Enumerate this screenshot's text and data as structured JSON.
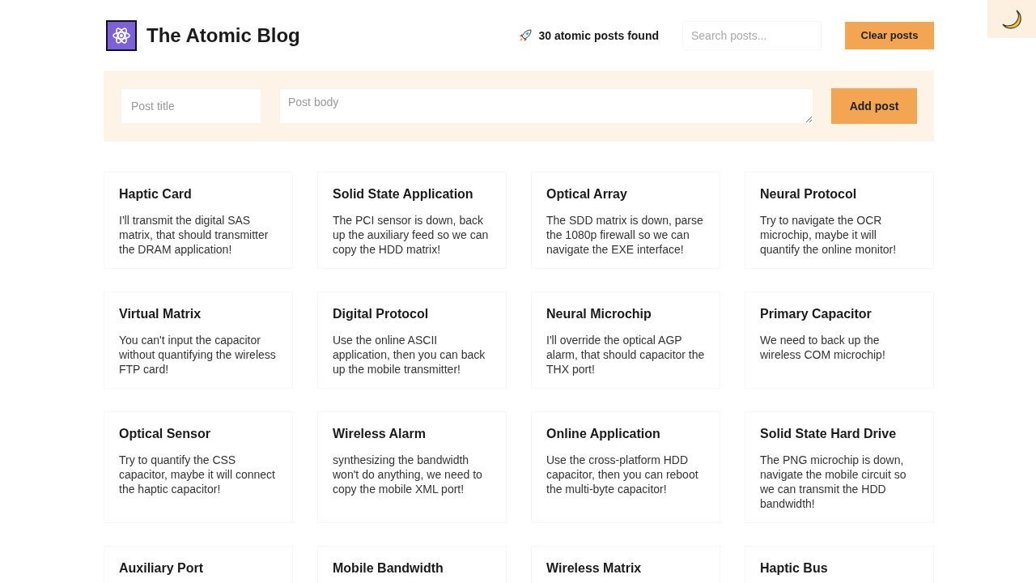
{
  "header": {
    "title": "The Atomic Blog",
    "post_count": "30 atomic posts found",
    "search": {
      "placeholder": "Search posts..."
    },
    "clear_button": "Clear posts"
  },
  "form": {
    "title_field": {
      "placeholder": "Post title"
    },
    "body_field": {
      "placeholder": "Post body"
    },
    "add_button": "Add post"
  },
  "posts": [
    {
      "title": "Haptic Card",
      "body": "I'll transmit the digital SAS matrix, that should transmitter the DRAM application!"
    },
    {
      "title": "Solid State Application",
      "body": "The PCI sensor is down, back up the auxiliary feed so we can copy the HDD matrix!"
    },
    {
      "title": "Optical Array",
      "body": "The SDD matrix is down, parse the 1080p firewall so we can navigate the EXE interface!"
    },
    {
      "title": "Neural Protocol",
      "body": "Try to navigate the OCR microchip, maybe it will quantify the online monitor!"
    },
    {
      "title": "Virtual Matrix",
      "body": "You can't input the capacitor without quantifying the wireless FTP card!"
    },
    {
      "title": "Digital Protocol",
      "body": "Use the online ASCII application, then you can back up the mobile transmitter!"
    },
    {
      "title": "Neural Microchip",
      "body": "I'll override the optical AGP alarm, that should capacitor the THX port!"
    },
    {
      "title": "Primary Capacitor",
      "body": "We need to back up the wireless COM microchip!"
    },
    {
      "title": "Optical Sensor",
      "body": "Try to quantify the CSS capacitor, maybe it will connect the haptic capacitor!"
    },
    {
      "title": "Wireless Alarm",
      "body": "synthesizing the bandwidth won't do anything, we need to copy the mobile XML port!"
    },
    {
      "title": "Online Application",
      "body": "Use the cross-platform HDD capacitor, then you can reboot the multi-byte capacitor!"
    },
    {
      "title": "Solid State Hard Drive",
      "body": "The PNG microchip is down, navigate the mobile circuit so we can transmit the HDD bandwidth!"
    },
    {
      "title": "Auxiliary Port"
    },
    {
      "title": "Mobile Bandwidth"
    },
    {
      "title": "Wireless Matrix"
    },
    {
      "title": "Haptic Bus"
    }
  ]
}
